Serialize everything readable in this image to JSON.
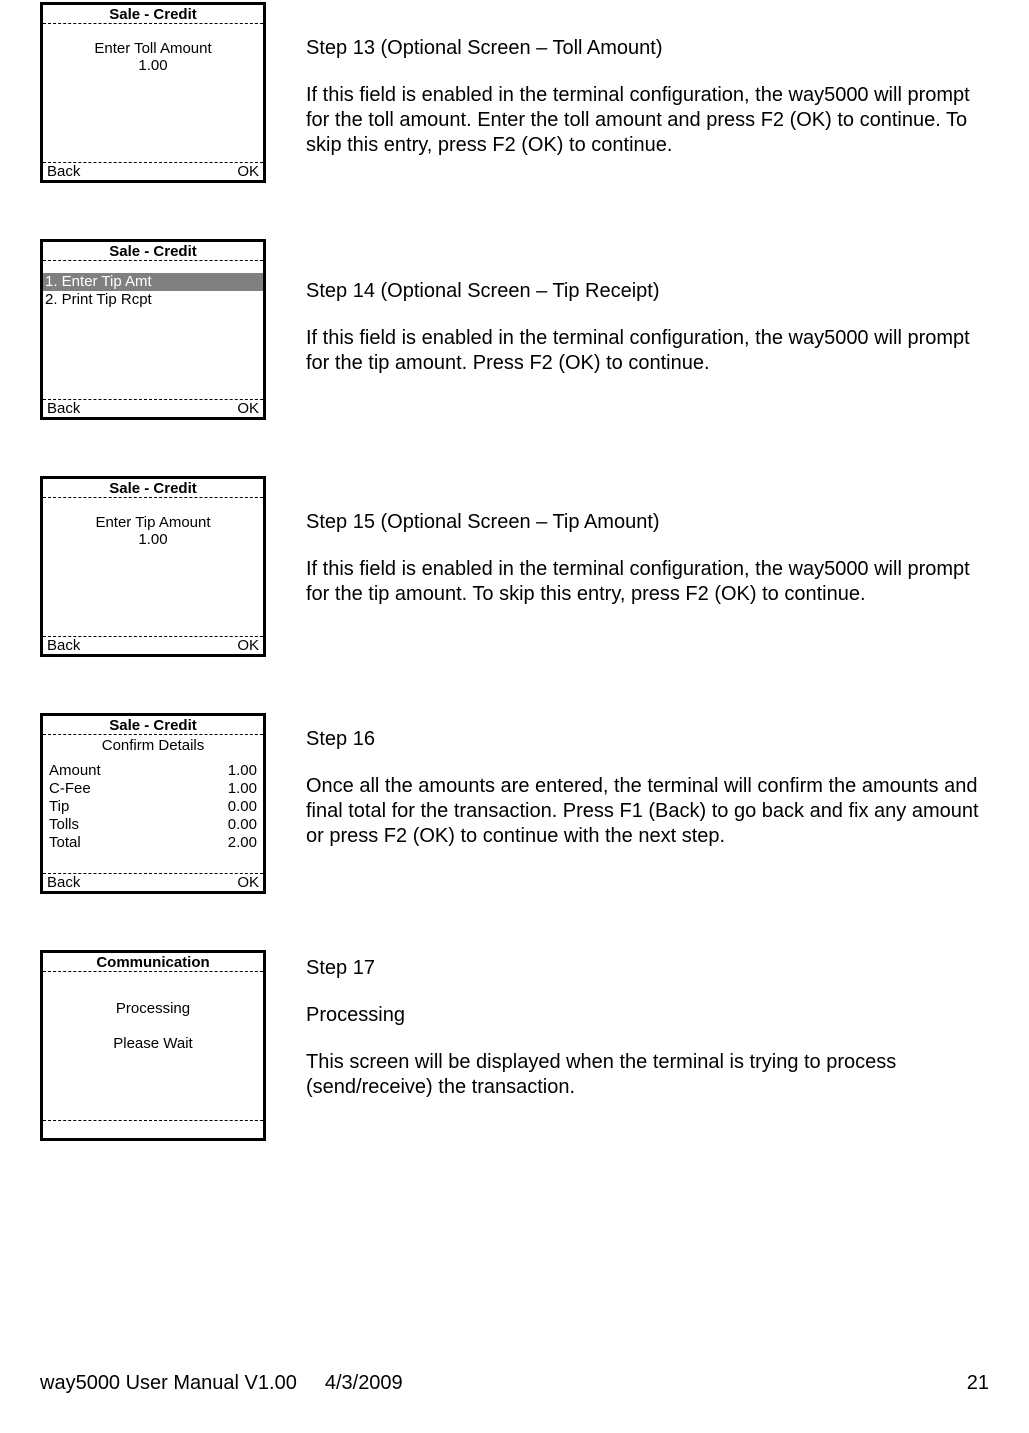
{
  "footer": {
    "label": "way5000 User Manual V1.00",
    "date": "4/3/2009",
    "page": "21"
  },
  "s13": {
    "title": "Sale - Credit",
    "prompt": "Enter Toll Amount",
    "value": "1.00",
    "back": "Back",
    "ok": "OK",
    "heading": "Step 13 (Optional Screen – Toll Amount)",
    "body": "If this field is enabled in the terminal configuration, the way5000 will prompt for the toll amount. Enter the toll amount and press F2 (OK) to continue. To skip this entry, press F2 (OK) to continue."
  },
  "s14": {
    "title": "Sale - Credit",
    "opt1": "1. Enter Tip Amt",
    "opt2": "2. Print Tip Rcpt",
    "back": "Back",
    "ok": "OK",
    "heading": "Step 14 (Optional Screen – Tip Receipt)",
    "body": "If this field is enabled in the terminal configuration, the way5000 will prompt for the tip amount. Press F2 (OK) to continue."
  },
  "s15": {
    "title": "Sale - Credit",
    "prompt": "Enter Tip Amount",
    "value": "1.00",
    "back": "Back",
    "ok": "OK",
    "heading": "Step 15 (Optional Screen – Tip Amount)",
    "body": "If this field is enabled in the terminal configuration, the way5000 will prompt for the tip amount. To skip this entry, press F2 (OK) to continue."
  },
  "s16": {
    "title": "Sale - Credit",
    "subtitle": "Confirm Details",
    "rows": {
      "amount_l": "Amount",
      "amount_v": "1.00",
      "cfee_l": "C-Fee",
      "cfee_v": "1.00",
      "tip_l": "Tip",
      "tip_v": "0.00",
      "tolls_l": "Tolls",
      "tolls_v": "0.00",
      "total_l": "Total",
      "total_v": "2.00"
    },
    "back": "Back",
    "ok": "OK",
    "heading": "Step 16",
    "body": "Once all the amounts are entered, the terminal will confirm the amounts and final total for the transaction. Press F1 (Back) to go back and fix any amount or press F2 (OK) to continue with the next step."
  },
  "s17": {
    "title": "Communication",
    "line1": "Processing",
    "line2": "Please Wait",
    "heading": "Step 17",
    "sub": "Processing",
    "body": "This screen will be displayed when the terminal is trying to process (send/receive) the transaction."
  }
}
